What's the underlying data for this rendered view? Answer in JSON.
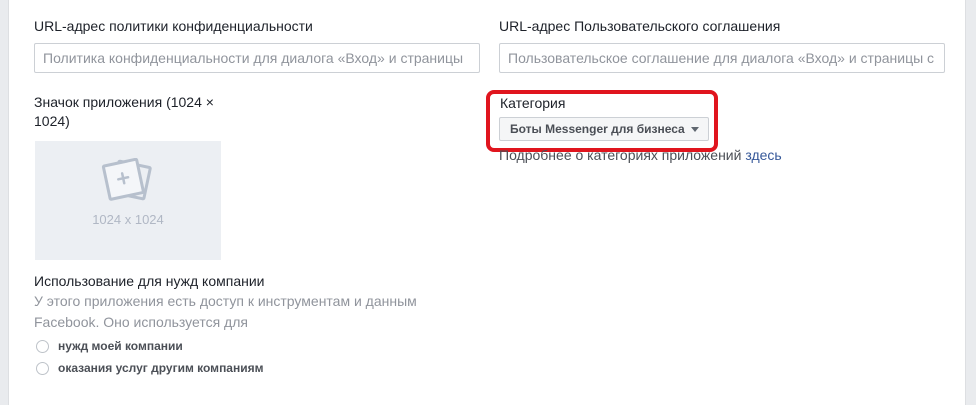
{
  "privacy": {
    "label": "URL-адрес политики конфиденциальности",
    "placeholder": "Политика конфиденциальности для диалога «Вход» и страницы",
    "value": ""
  },
  "terms": {
    "label": "URL-адрес Пользовательского соглашения",
    "placeholder": "Пользовательское соглашение для диалога «Вход» и страницы с",
    "value": ""
  },
  "app_icon": {
    "label_line1": "Значок приложения (1024 ×",
    "label_line2": "1024)",
    "size_text": "1024 x 1024",
    "icon": "image-placeholder-icon"
  },
  "category": {
    "label": "Категория",
    "selected": "Боты Messenger для бизнеса",
    "more_text": "Подробнее о категориях приложений ",
    "more_link": "здесь",
    "highlight_color": "#e0151e"
  },
  "business_use": {
    "title": "Использование для нужд компании",
    "description_line1": "У этого приложения есть доступ к инструментам и данным",
    "description_line2": "Facebook. Оно используется для",
    "options": [
      {
        "label": "нужд моей компании",
        "checked": false
      },
      {
        "label": "оказания услуг другим компаниям",
        "checked": false
      }
    ]
  },
  "colors": {
    "link": "#365899",
    "page_bg": "#e9ebee",
    "placeholder_text": "#90949c"
  }
}
